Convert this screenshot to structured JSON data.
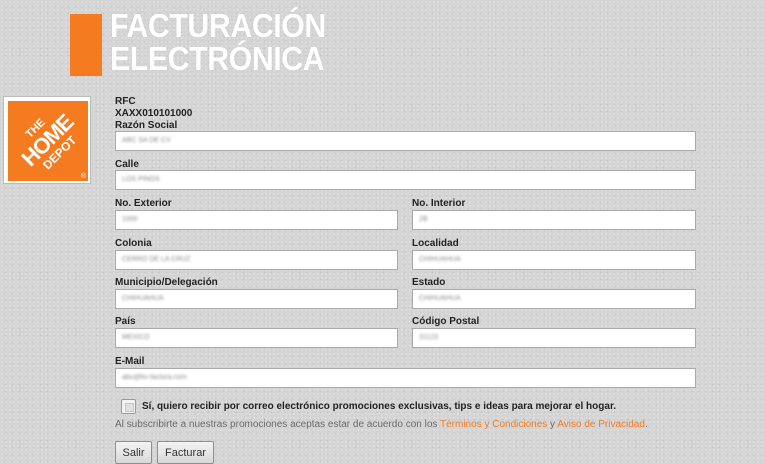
{
  "header": {
    "title_line1": "FACTURACIÓN",
    "title_line2": "ELECTRÓNICA",
    "accent_color": "#f47b20"
  },
  "logo": {
    "line1": "THE",
    "line2": "HOME",
    "line3": "DEPOT",
    "reg": "®"
  },
  "form": {
    "rfc_label": "RFC",
    "rfc_value": "XAXX010101000",
    "razon_social": {
      "label": "Razón Social",
      "value": "ABC SA DE CV"
    },
    "calle": {
      "label": "Calle",
      "value": "LOS PINOS"
    },
    "no_exterior": {
      "label": "No. Exterior",
      "value": "1000"
    },
    "no_interior": {
      "label": "No. Interior",
      "value": "2B"
    },
    "colonia": {
      "label": "Colonia",
      "value": "CERRO DE LA CRUZ"
    },
    "localidad": {
      "label": "Localidad",
      "value": "CHIHUAHUA"
    },
    "municipio": {
      "label": "Municipio/Delegación",
      "value": "CHIHUAHUA"
    },
    "estado": {
      "label": "Estado",
      "value": "CHIHUAHUA"
    },
    "pais": {
      "label": "País",
      "value": "MEXICO"
    },
    "codigo_postal": {
      "label": "Código Postal",
      "value": "31123"
    },
    "email": {
      "label": "E-Mail",
      "value": "abc@bv-factura.com"
    },
    "promo_checkbox_label": "Sí, quiero recibir por correo electrónico promociones exclusivas, tips e ideas para mejorar el hogar.",
    "promo_checked": false,
    "notice_prefix": "Al subscribirte a nuestras promociones aceptas estar de acuerdo con los ",
    "terms_link": "Términos y Condiciones",
    "notice_and": " y ",
    "privacy_link": "Aviso de Privacidad",
    "notice_suffix": "."
  },
  "buttons": {
    "salir": "Salir",
    "facturar": "Facturar"
  }
}
